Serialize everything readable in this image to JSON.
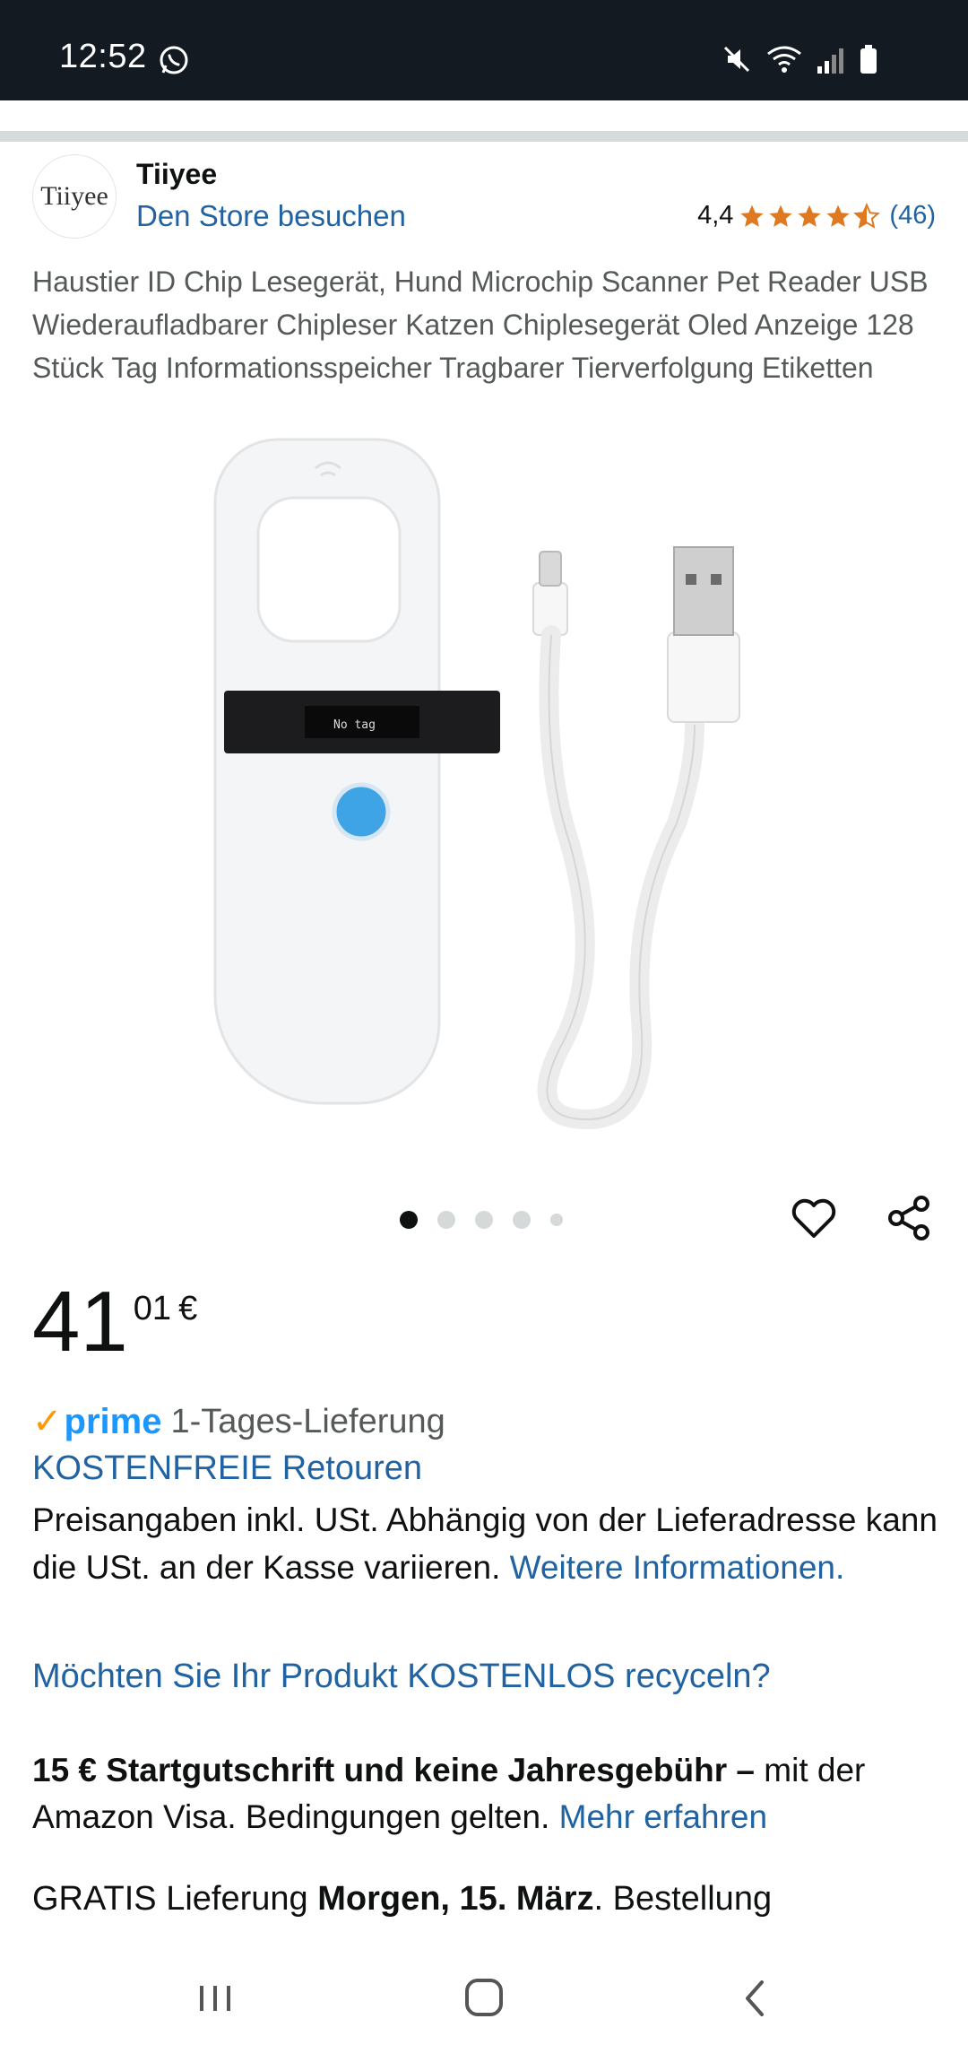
{
  "status_bar": {
    "time": "12:52"
  },
  "store": {
    "logo_text": "Tiiyee",
    "name": "Tiiyee",
    "visit_link": "Den Store besuchen",
    "rating_value": "4,4",
    "rating_stars": 4.4,
    "rating_count": "(46)"
  },
  "product": {
    "title": "Haustier ID Chip Lesegerät, Hund Microchip Scanner Pet Reader USB Wiederaufladbarer Chipleser Katzen Chiplesegerät Oled Anzeige 128 Stück Tag Informationsspeicher Tragbarer Tierverfolgung Etiketten",
    "screen_text": "No tag",
    "image_count": 5,
    "active_image": 1
  },
  "price": {
    "whole": "41",
    "cents": "01",
    "currency": "€"
  },
  "prime": {
    "logo": "prime",
    "delivery": "1-Tages-Lieferung"
  },
  "returns": "KOSTENFREIE Retouren",
  "tax_note": {
    "text": "Preisangaben inkl. USt. Abhängig von der Lieferadresse kann die USt. an der Kasse variieren.",
    "link": "Weitere Informationen."
  },
  "recycle_link": "Möchten Sie Ihr Produkt KOSTENLOS recyceln?",
  "visa": {
    "bold": "15 € Startgutschrift und keine Jahresgebühr –",
    "text": "mit der Amazon Visa. Bedingungen gelten.",
    "link": "Mehr erfahren"
  },
  "delivery": {
    "prefix": "GRATIS Lieferung",
    "date": "Morgen, 15. März",
    "suffix": ". Bestellung"
  },
  "colors": {
    "link": "#2162a1",
    "star": "#de7921",
    "prime": "#1a98ff",
    "status_bar": "#131a22"
  }
}
